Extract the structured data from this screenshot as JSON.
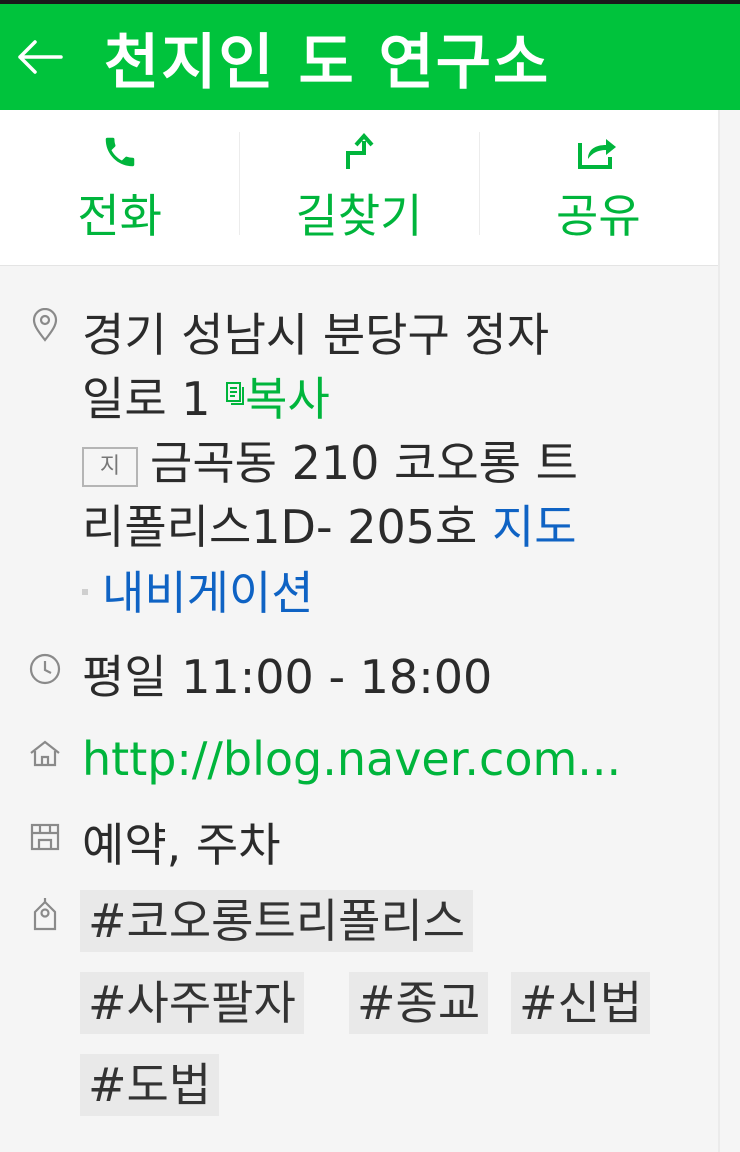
{
  "header": {
    "title": "천지인 도 연구소"
  },
  "actions": {
    "call": "전화",
    "directions": "길찾기",
    "share": "공유"
  },
  "address": {
    "line1": "경기 성남시 분당구 정자",
    "line2": "일로 1",
    "copy": "복사",
    "jibun_badge": "지",
    "jibun_line1": "금곡동 210 코오롱 트",
    "jibun_line2": "리폴리스1D- 205호",
    "map": "지도",
    "navigation": "내비게이션"
  },
  "hours": "평일 11:00 - 18:00",
  "homepage": "http://blog.naver.com...",
  "services": "예약, 주차",
  "tags": [
    "#코오롱트리폴리스",
    "#사주팔자",
    "#종교",
    "#신법",
    "#도법"
  ],
  "colors": {
    "brand": "#00c33c",
    "link_green": "#00b53c",
    "link_blue": "#0f63c4"
  }
}
